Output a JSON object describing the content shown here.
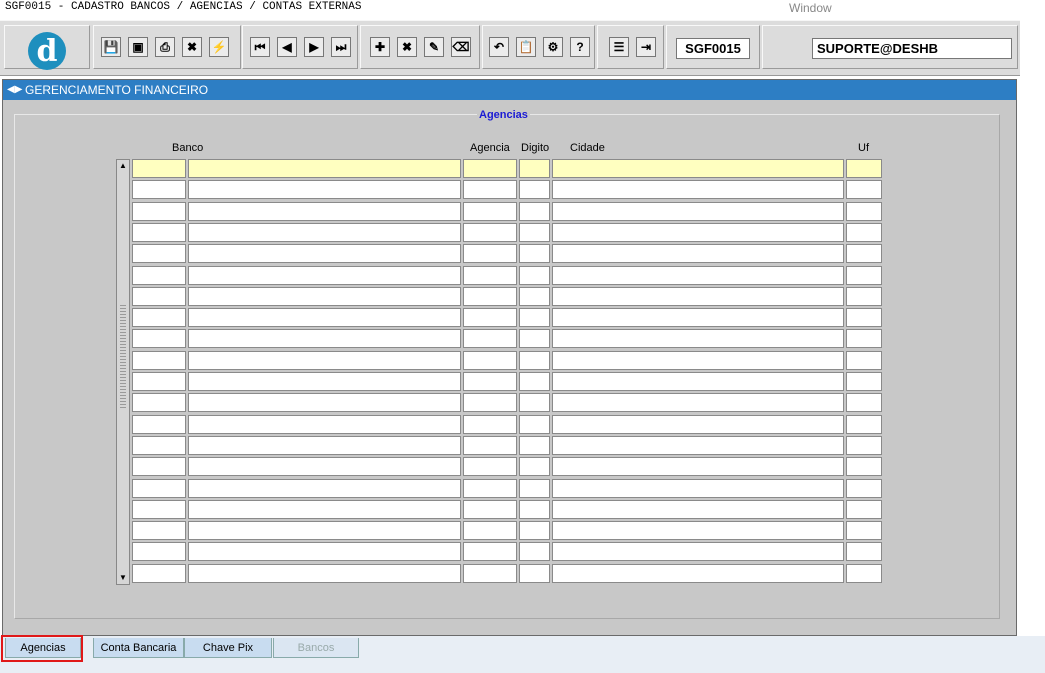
{
  "window": {
    "title": "SGF0015 - CADASTRO BANCOS / AGENCIAS / CONTAS EXTERNAS",
    "menu_label": "Window"
  },
  "toolbar": {
    "logo_letter": "d",
    "buttons": [
      {
        "name": "save-icon",
        "glyph": "💾"
      },
      {
        "name": "monitor-icon",
        "glyph": "▣"
      },
      {
        "name": "print-icon",
        "glyph": "⎙"
      },
      {
        "name": "clear-icon",
        "glyph": "✖"
      },
      {
        "name": "wand-icon",
        "glyph": "⚡"
      },
      {
        "name": "first-record-icon",
        "glyph": "⏮"
      },
      {
        "name": "prev-record-icon",
        "glyph": "◀"
      },
      {
        "name": "next-record-icon",
        "glyph": "▶"
      },
      {
        "name": "last-record-icon",
        "glyph": "⏭"
      },
      {
        "name": "insert-record-icon",
        "glyph": "✚"
      },
      {
        "name": "delete-record-icon",
        "glyph": "✖"
      },
      {
        "name": "edit-record-icon",
        "glyph": "✎"
      },
      {
        "name": "clear-record-icon",
        "glyph": "⌫"
      },
      {
        "name": "undo-icon",
        "glyph": "↶"
      },
      {
        "name": "clipboard-icon",
        "glyph": "📋"
      },
      {
        "name": "tools-icon",
        "glyph": "⚙"
      },
      {
        "name": "help-icon",
        "glyph": "?"
      },
      {
        "name": "menu-icon",
        "glyph": "☰"
      },
      {
        "name": "exit-icon",
        "glyph": "⇥"
      }
    ],
    "form_code": "SGF0015",
    "user": "SUPORTE@DESHB"
  },
  "frame": {
    "title": "GERENCIAMENTO FINANCEIRO",
    "group_title": "Agencias"
  },
  "columns": {
    "banco": "Banco",
    "agencia": "Agencia",
    "digito": "Digito",
    "cidade": "Cidade",
    "uf": "Uf"
  },
  "grid": {
    "visible_rows": 20
  },
  "tabs": [
    {
      "label": "Agencias",
      "state": "active"
    },
    {
      "label": "Conta Bancaria",
      "state": "normal"
    },
    {
      "label": "Chave Pix",
      "state": "normal"
    },
    {
      "label": "Bancos",
      "state": "disabled"
    }
  ],
  "colors": {
    "header_blue": "#2d7ec4",
    "current_row": "#ffffc0",
    "group_title": "#1b1bd4",
    "highlight": "#e01818"
  }
}
